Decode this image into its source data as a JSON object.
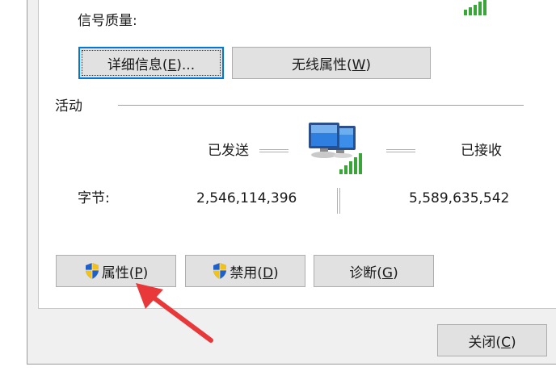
{
  "signal": {
    "label": "信号质量:"
  },
  "buttons_top": {
    "details_text": "详细信息(",
    "details_key": "E",
    "details_end": ")...",
    "wireless_text": "无线属性(",
    "wireless_key": "W",
    "wireless_end": ")"
  },
  "activity": {
    "section_label": "活动",
    "sent_label": "已发送",
    "received_label": "已接收",
    "bytes_label": "字节:",
    "bytes_sent": "2,546,114,396",
    "bytes_received": "5,589,635,542"
  },
  "buttons_bottom": {
    "properties_text": "属性(",
    "properties_key": "P",
    "properties_end": ")",
    "disable_text": "禁用(",
    "disable_key": "D",
    "disable_end": ")",
    "diagnose_text": "诊断(",
    "diagnose_key": "G",
    "diagnose_end": ")"
  },
  "footer": {
    "close_text": "关闭(",
    "close_key": "C",
    "close_end": ")"
  },
  "colors": {
    "accent": "#0078d7",
    "signal_green": "#3aa63a",
    "arrow_red": "#e8383a"
  },
  "icons": {
    "signal": "signal-bars-icon",
    "network": "network-computers-icon",
    "shield": "uac-shield-icon",
    "arrow": "annotation-arrow-icon"
  }
}
